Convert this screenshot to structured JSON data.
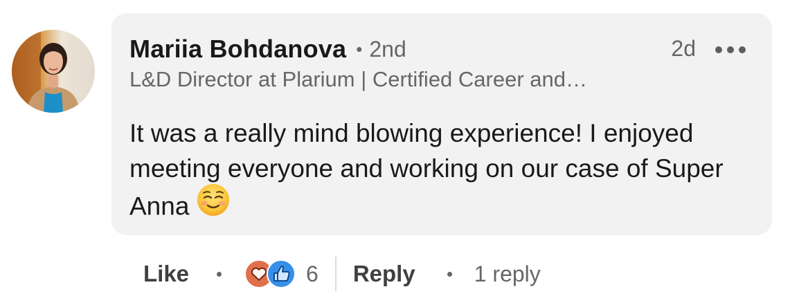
{
  "comment": {
    "author": {
      "name": "Mariia Bohdanova",
      "connection_degree": "2nd",
      "headline": "L&D Director at Plarium | Certified Career and…"
    },
    "timestamp": "2d",
    "more_icon": "more-horizontal-icon",
    "body": "It was a really mind blowing experience! I enjoyed meeting everyone and working on our case of Super Anna",
    "emoji": "smiling-face-icon"
  },
  "actions": {
    "like_label": "Like",
    "reactions": {
      "icons": [
        "love-reaction-icon",
        "like-reaction-icon"
      ],
      "count": "6"
    },
    "reply_label": "Reply",
    "reply_count": "1 reply"
  },
  "colors": {
    "bubble_bg": "#f2f2f2",
    "primary_text": "#191919",
    "secondary_text": "#666666",
    "love_reaction": "#df704d",
    "like_reaction": "#378fe9"
  }
}
